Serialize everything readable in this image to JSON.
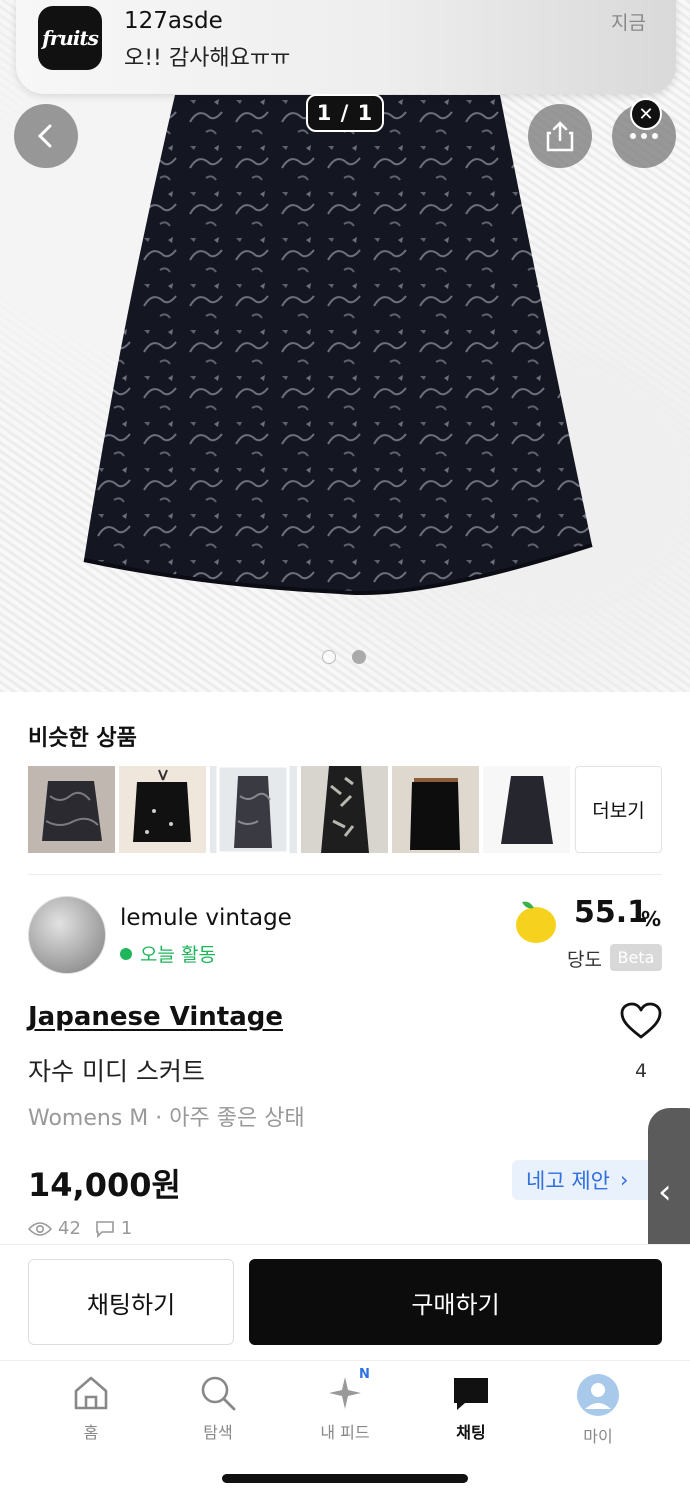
{
  "notification": {
    "icon_text": "fruits",
    "title": "127asde",
    "body": "오!! 감사해요ㅠㅠ",
    "time": "지금"
  },
  "photo": {
    "counter": "1 / 1",
    "page_total": 2,
    "page_current": 2
  },
  "similar": {
    "title": "비슷한 상품",
    "more_label": "더보기",
    "count": 6
  },
  "seller": {
    "name": "lemule vintage",
    "status": "오늘 활동",
    "score": "55.1",
    "score_unit": "%",
    "score_label": "당도",
    "beta_label": "Beta"
  },
  "product": {
    "brand": "Japanese Vintage",
    "name": "자수 미디 스커트",
    "meta": "Womens M · 아주 좋은 상태",
    "likes": "4",
    "price": "14,000원",
    "offer_label": "네고 제안",
    "views": "42",
    "chats": "1"
  },
  "actions": {
    "chat_label": "채팅하기",
    "buy_label": "구매하기"
  },
  "tabs": [
    {
      "label": "홈"
    },
    {
      "label": "탐색"
    },
    {
      "label": "내 피드",
      "badge": "N"
    },
    {
      "label": "채팅"
    },
    {
      "label": "마이"
    }
  ],
  "colors": {
    "accent_green": "#1fb55a",
    "offer_blue": "#2f6fe0",
    "dark": "#0c0c0c"
  }
}
